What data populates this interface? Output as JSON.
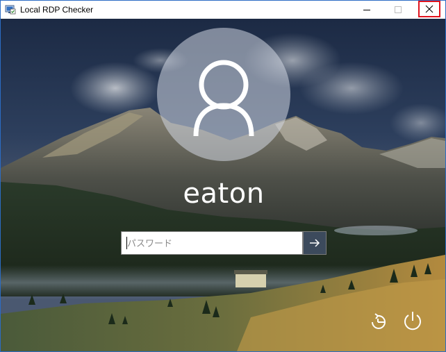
{
  "window": {
    "title": "Local RDP Checker",
    "icon": "rdp-app-icon",
    "controls": {
      "minimize": "minimize-icon",
      "maximize": "maximize-icon",
      "close": "close-icon"
    },
    "close_highlight_color": "#e0141e"
  },
  "login": {
    "username": "eaton",
    "password_placeholder": "パスワード",
    "password_value": "",
    "submit_icon": "arrow-right-icon"
  },
  "corner_buttons": {
    "ease_of_access": "ease-of-access-icon",
    "power": "power-icon"
  },
  "colors": {
    "submit_bg": "#3c4a5c",
    "text": "#ffffff"
  }
}
